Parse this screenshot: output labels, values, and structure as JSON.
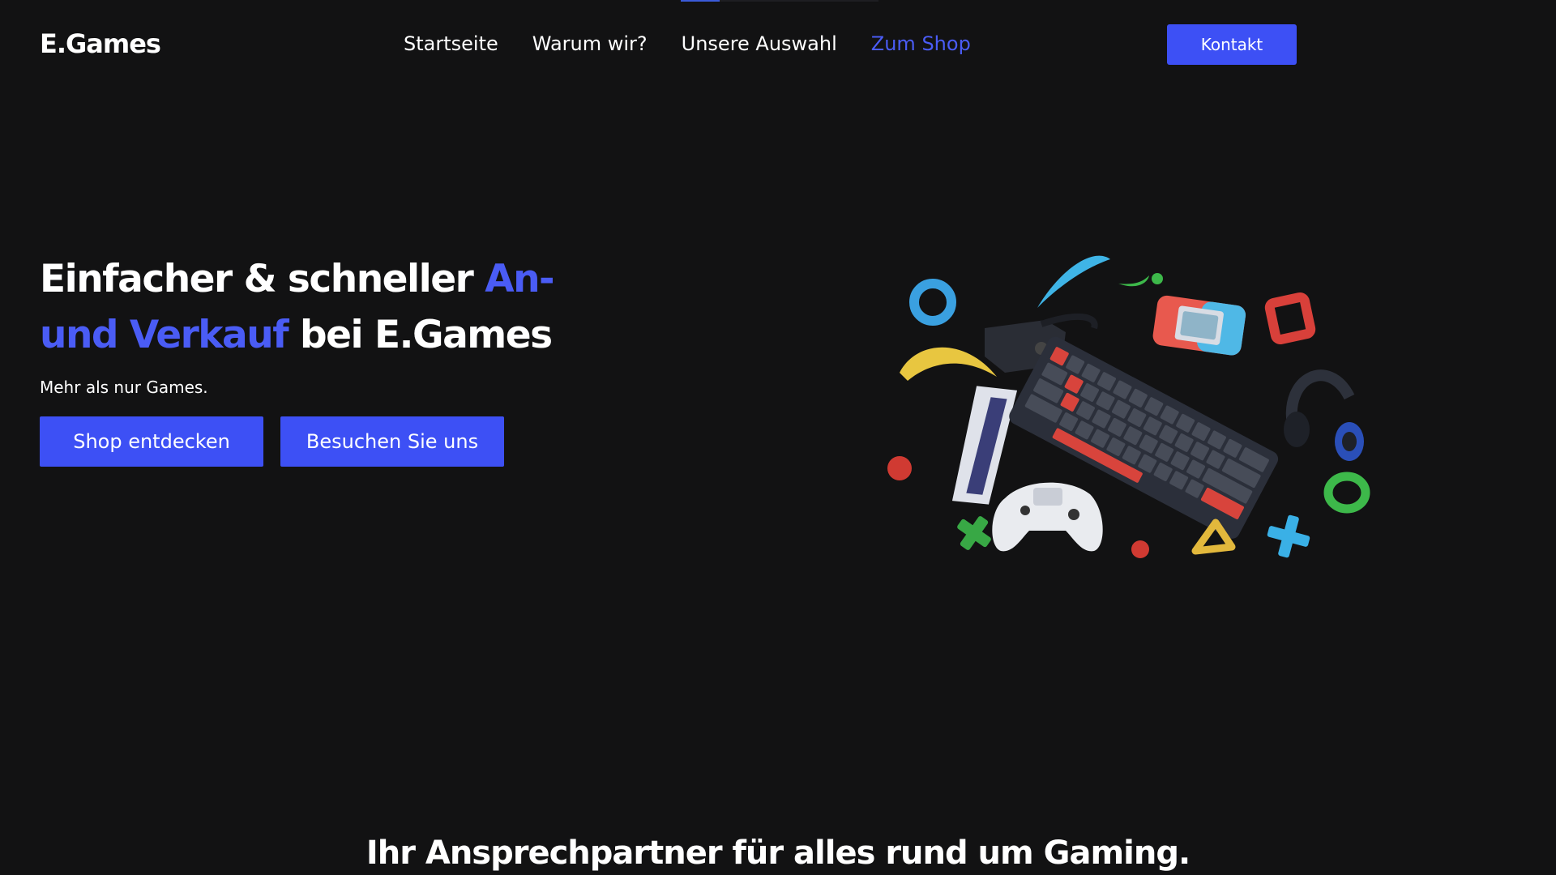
{
  "brand": {
    "logo": "E.Games"
  },
  "nav": {
    "items": [
      {
        "label": "Startseite"
      },
      {
        "label": "Warum wir?"
      },
      {
        "label": "Unsere Auswahl"
      },
      {
        "label": "Zum Shop"
      }
    ],
    "contact_label": "Kontakt"
  },
  "hero": {
    "title_part1": "Einfacher & schneller ",
    "title_highlight": "An- und Verkauf",
    "title_part2": " bei E.Games",
    "subtitle": "Mehr als nur Games.",
    "primary_button": "Shop entdecken",
    "secondary_button": "Besuchen Sie uns",
    "illustration_icons": [
      "gaming-illustration",
      "keyboard-icon",
      "controller-icon",
      "headphones-icon",
      "vr-headset-icon",
      "handheld-console-icon"
    ]
  },
  "section": {
    "title": "Ihr Ansprechpartner für alles rund um Gaming."
  },
  "colors": {
    "background": "#121213",
    "accent": "#3d50f5",
    "accent_text": "#4a5cf5",
    "text": "#ffffff"
  }
}
